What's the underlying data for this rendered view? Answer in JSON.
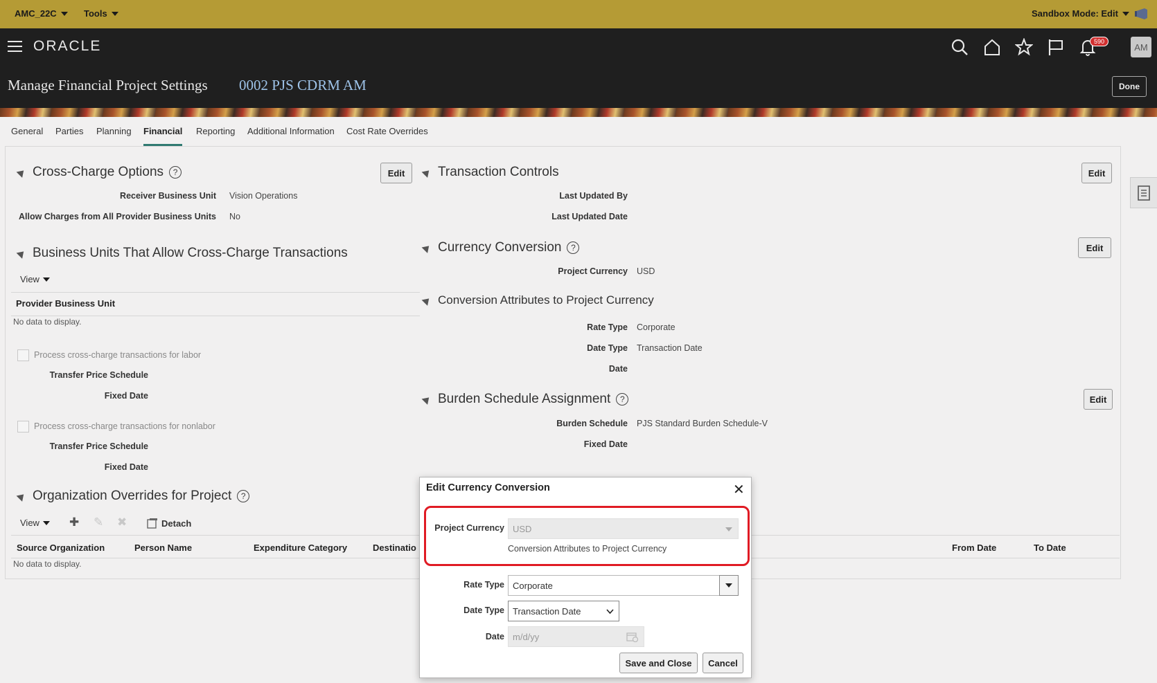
{
  "sandbox": {
    "workspace": "AMC_22C",
    "tools": "Tools",
    "mode": "Sandbox Mode: Edit"
  },
  "header": {
    "logo": "ORACLE",
    "notifications_count": "590",
    "avatar": "AM",
    "title": "Manage Financial Project Settings",
    "subtitle": "0002 PJS CDRM AM",
    "done_label": "Done"
  },
  "tabs": [
    "General",
    "Parties",
    "Planning",
    "Financial",
    "Reporting",
    "Additional Information",
    "Cost Rate Overrides"
  ],
  "cross_charge": {
    "title": "Cross-Charge Options",
    "edit_label": "Edit",
    "receiver_label": "Receiver Business Unit",
    "receiver_value": "Vision Operations",
    "allow_label": "Allow Charges from All Provider Business Units",
    "allow_value": "No"
  },
  "bu_section": {
    "title": "Business Units That Allow Cross-Charge Transactions",
    "view_label": "View",
    "column": "Provider Business Unit",
    "no_data": "No data to display.",
    "labor_label": "Process cross-charge transactions for labor",
    "nonlabor_label": "Process cross-charge transactions for nonlabor",
    "tps_label": "Transfer Price Schedule",
    "fixed_date_label": "Fixed Date"
  },
  "org_overrides": {
    "title": "Organization Overrides for Project",
    "view_label": "View",
    "detach_label": "Detach",
    "columns": [
      "Source Organization",
      "Person Name",
      "Expenditure Category",
      "Destinatio"
    ],
    "right_columns": [
      "From Date",
      "To Date"
    ],
    "no_data": "No data to display."
  },
  "transaction_controls": {
    "title": "Transaction Controls",
    "edit_label": "Edit",
    "updated_by_label": "Last Updated By",
    "updated_date_label": "Last Updated Date"
  },
  "currency": {
    "title": "Currency Conversion",
    "edit_label": "Edit",
    "project_currency_label": "Project Currency",
    "project_currency_value": "USD",
    "attr_title": "Conversion Attributes to Project Currency",
    "rate_type_label": "Rate Type",
    "rate_type_value": "Corporate",
    "date_type_label": "Date Type",
    "date_type_value": "Transaction Date",
    "date_label": "Date"
  },
  "burden": {
    "title": "Burden Schedule Assignment",
    "edit_label": "Edit",
    "schedule_label": "Burden Schedule",
    "schedule_value": "PJS Standard Burden Schedule-V",
    "fixed_date_label": "Fixed Date"
  },
  "dialog": {
    "title": "Edit Currency Conversion",
    "project_currency_label": "Project Currency",
    "project_currency_value": "USD",
    "attr_caption": "Conversion Attributes to Project Currency",
    "rate_type_label": "Rate Type",
    "rate_type_value": "Corporate",
    "date_type_label": "Date Type",
    "date_type_value": "Transaction Date",
    "date_label": "Date",
    "date_placeholder": "m/d/yy",
    "save_label": "Save and Close",
    "cancel_label": "Cancel"
  },
  "colors": {
    "sandbox_bar": "#b59b35",
    "header": "#1f1f1f",
    "active_tab": "#2f7a71",
    "highlight": "#e01b24"
  }
}
